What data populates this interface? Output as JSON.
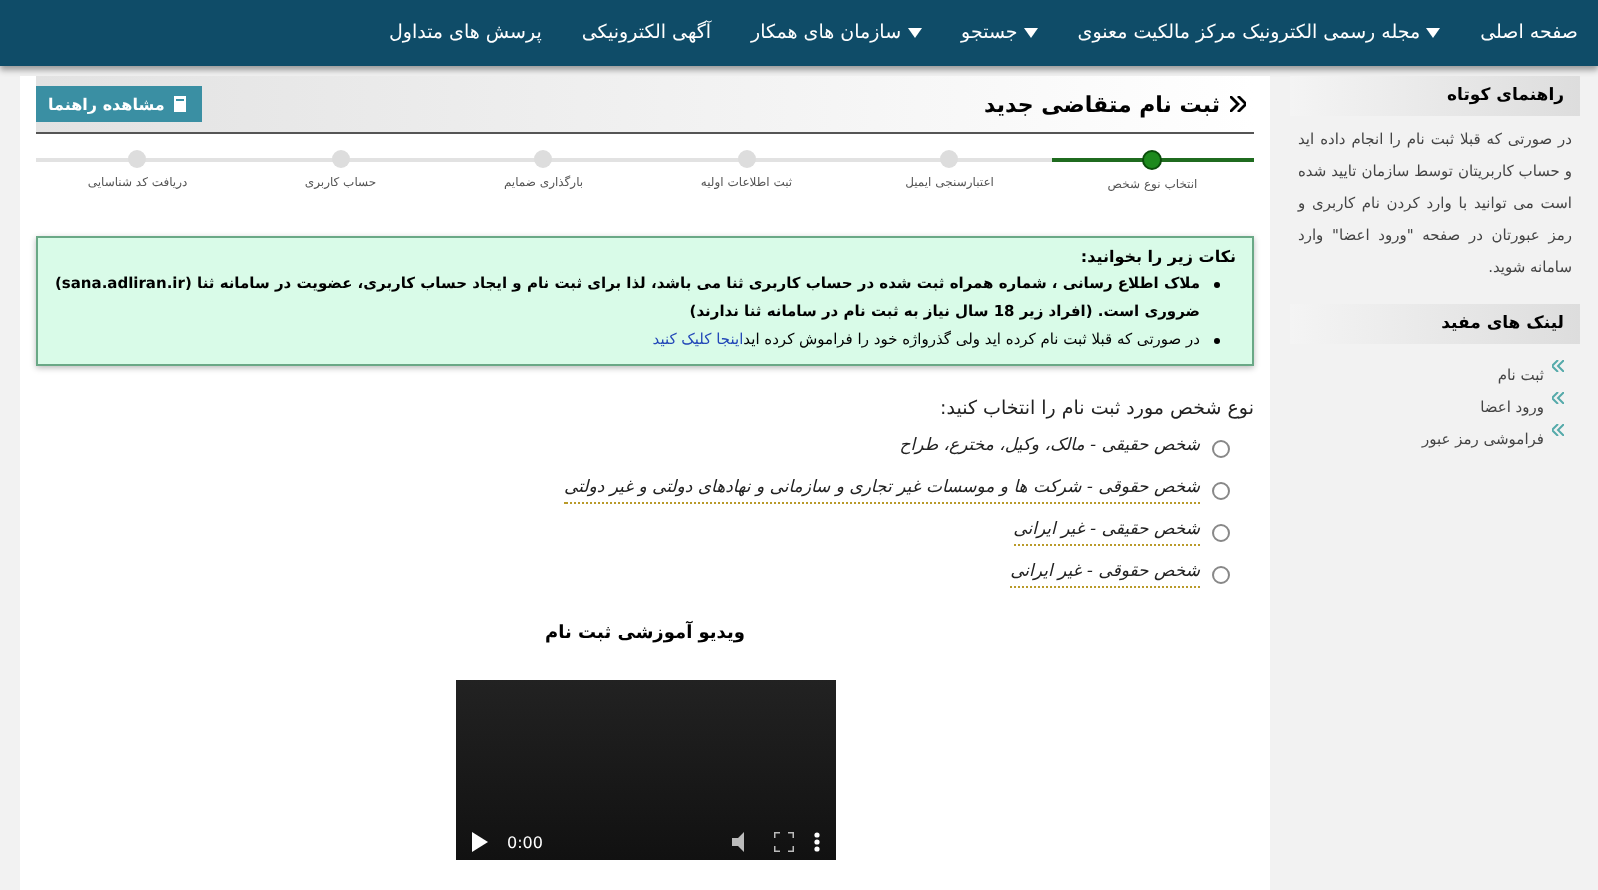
{
  "nav": [
    {
      "label": "صفحه اصلی",
      "dropdown": false
    },
    {
      "label": "مجله رسمی الکترونیک مرکز مالکیت معنوی",
      "dropdown": true
    },
    {
      "label": "جستجو",
      "dropdown": true
    },
    {
      "label": "سازمان های همکار",
      "dropdown": true
    },
    {
      "label": "آگهی الکترونیکی",
      "dropdown": false
    },
    {
      "label": "پرسش های متداول",
      "dropdown": false
    }
  ],
  "page": {
    "title": "ثبت نام متقاضی جدید",
    "guide_button": "مشاهده راهنما"
  },
  "steps": [
    {
      "label": "انتخاب نوع شخص",
      "selected": true
    },
    {
      "label": "اعتبارسنجی ایمیل",
      "selected": false
    },
    {
      "label": "ثبت اطلاعات اولیه",
      "selected": false
    },
    {
      "label": "بارگذاری ضمایم",
      "selected": false
    },
    {
      "label": "حساب کاربری",
      "selected": false
    },
    {
      "label": "دریافت کد شناسایی",
      "selected": false
    }
  ],
  "notes": {
    "heading": "نکات زیر را بخوانید:",
    "items": [
      {
        "text": "ملاک اطلاع رسانی ، شماره همراه ثبت شده در حساب کاربری ثنا می باشد، لذا برای ثبت نام و ایجاد حساب کاربری، عضویت در سامانه ثنا (sana.adliran.ir) ضروری است. (افراد زیر 18 سال نیاز به ثبت نام در سامانه ثنا ندارند)",
        "bold": true
      },
      {
        "text": "در صورتی که قبلا ثبت نام کرده اید ولی گذرواژه خود را فراموش کرده اید",
        "link": "اینجا کلیک کنید",
        "bold": false
      }
    ]
  },
  "person_type": {
    "question": "نوع شخص مورد ثبت نام را انتخاب کنید:",
    "options": [
      {
        "label": "شخص حقیقی - مالک، وکیل، مخترع، طراح",
        "selected": false,
        "underlined": false
      },
      {
        "label": "شخص حقوقی - شرکت ها و موسسات غیر تجاری و سازمانی و نهادهای دولتی و غیر دولتی",
        "selected": false,
        "underlined": true
      },
      {
        "label": "شخص حقیقی - غیر ایرانی",
        "selected": false,
        "underlined": true
      },
      {
        "label": "شخص حقوقی - غیر ایرانی",
        "selected": false,
        "underlined": true
      }
    ]
  },
  "video": {
    "title": "ویدیو آموزشی ثبت نام",
    "time": "0:00"
  },
  "sidebar": {
    "guide_title": "راهنمای کوتاه",
    "guide_text": "در صورتی که قبلا ثبت نام را انجام داده اید و حساب کاربریتان توسط سازمان تایید شده است می توانید با وارد کردن نام کاربری و رمز عبورتان در صفحه \"ورود اعضا\" وارد سامانه شوید.",
    "links_title": "لینک های مفید",
    "links": [
      "ثبت نام",
      "ورود اعضا",
      "فراموشی رمز عبور"
    ]
  }
}
